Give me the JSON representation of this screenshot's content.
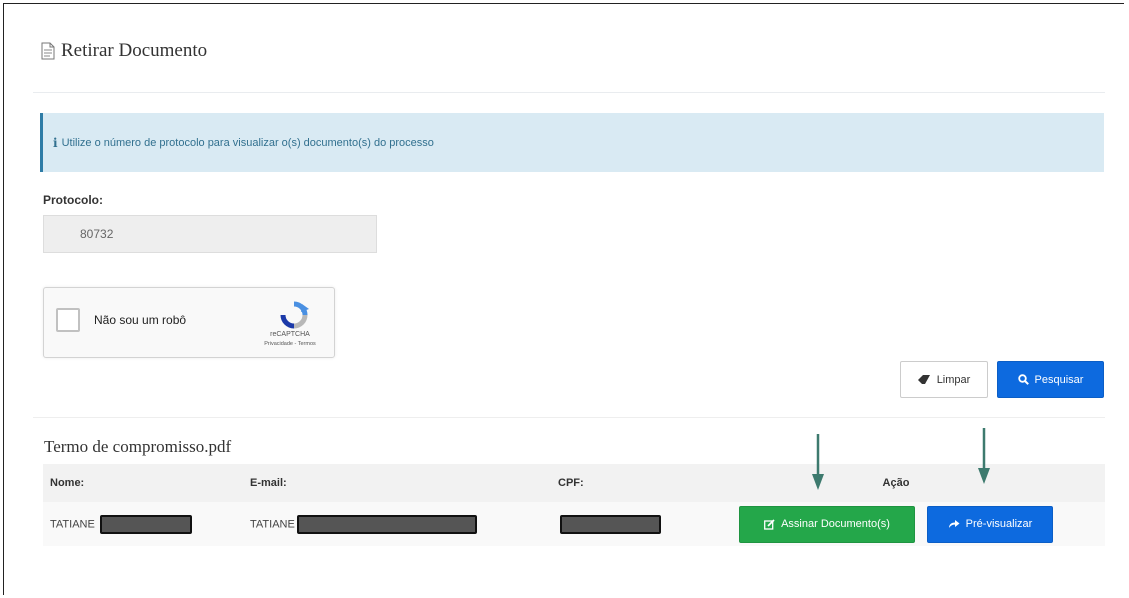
{
  "page": {
    "title": "Retirar Documento",
    "title_icon": "file-text-icon"
  },
  "alert": {
    "icon": "info-icon",
    "icon_glyph": "i",
    "text": "Utilize o número de protocolo para visualizar o(s) documento(s) do processo"
  },
  "form": {
    "protocolo_label": "Protocolo:",
    "protocolo_value": "80732"
  },
  "captcha": {
    "label": "Não sou um robô",
    "brand": "reCAPTCHA",
    "links": "Privacidade - Termos"
  },
  "buttons": {
    "limpar": "Limpar",
    "limpar_icon": "eraser-icon",
    "pesquisar": "Pesquisar",
    "pesquisar_icon": "search-icon"
  },
  "results": {
    "document_name": "Termo de compromisso.pdf",
    "columns": [
      "Nome:",
      "E-mail:",
      "CPF:",
      "Ação"
    ],
    "rows": [
      {
        "nome": "TATIANE",
        "email": "TATIANE",
        "cpf": "",
        "actions": {
          "assinar": "Assinar Documento(s)",
          "assinar_icon": "edit-icon",
          "previsualizar": "Pré-visualizar",
          "previsualizar_icon": "share-icon"
        }
      }
    ]
  },
  "colors": {
    "primary": "#0d6adf",
    "success": "#24a74a",
    "alert_bg": "#d9eaf3",
    "alert_border": "#2e7ca6",
    "annotation_arrow": "#3d7a6e"
  }
}
